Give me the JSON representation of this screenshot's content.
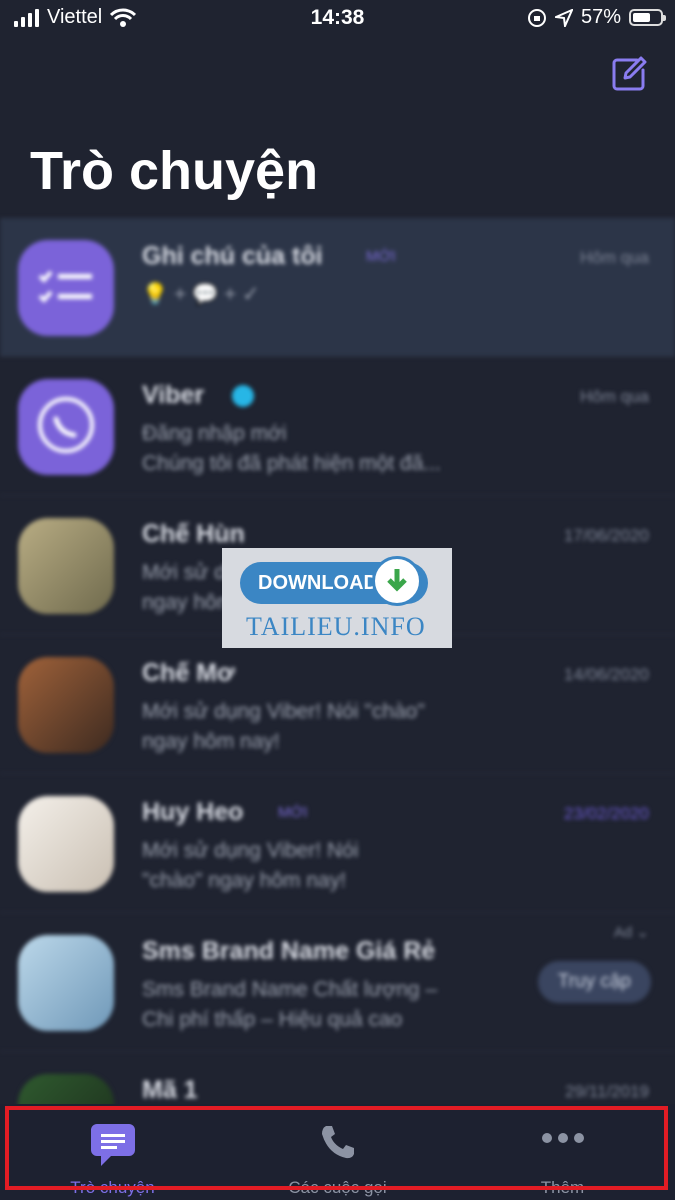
{
  "status_bar": {
    "carrier": "Viettel",
    "time": "14:38",
    "battery_percent": "57%",
    "battery_level": 0.57
  },
  "header": {
    "title": "Trò chuyện",
    "compose_icon": "compose-icon"
  },
  "chats": [
    {
      "name": "Ghi chú của tôi",
      "tag": "MỚI",
      "preview": "💡 + 💬 + ✓",
      "date": "Hôm qua"
    },
    {
      "name": "Viber",
      "preview": "Đăng nhập mới\nChúng tôi đã phát hiện một đă...",
      "date": "Hôm qua"
    },
    {
      "name": "Chế Hùn",
      "preview": "Mới sử dụng Viber! Nói \"chào\"\nngay hôm nay!",
      "date": "17/06/2020"
    },
    {
      "name": "Chế Mơ",
      "preview": "Mới sử dụng Viber! Nói \"chào\"\nngay hôm nay!",
      "date": "14/06/2020"
    },
    {
      "name": "Huy Heo",
      "tag": "MỚI",
      "preview": "Mới sử dụng Viber! Nói\n\"chào\" ngay hôm nay!",
      "date": "23/02/2020"
    },
    {
      "name": "Sms Brand Name Giá Rẻ",
      "preview": "Sms Brand Name Chất lượng –\nChi phí thấp – Hiệu quả cao",
      "ad_label": "Ad",
      "visit_label": "Truy cập"
    },
    {
      "name": "Mã 1",
      "date": "29/11/2019"
    }
  ],
  "watermark": {
    "button": "DOWNLOAD",
    "site": "TAILIEU.INFO"
  },
  "tabs": [
    {
      "label": "Trò chuyện",
      "icon": "chat-bubble-icon",
      "active": true
    },
    {
      "label": "Các cuộc gọi",
      "icon": "phone-icon",
      "active": false
    },
    {
      "label": "Thêm",
      "icon": "more-icon",
      "active": false
    }
  ],
  "colors": {
    "background": "#1f2330",
    "accent": "#7d6fe6",
    "highlight_border": "#e21c24"
  }
}
